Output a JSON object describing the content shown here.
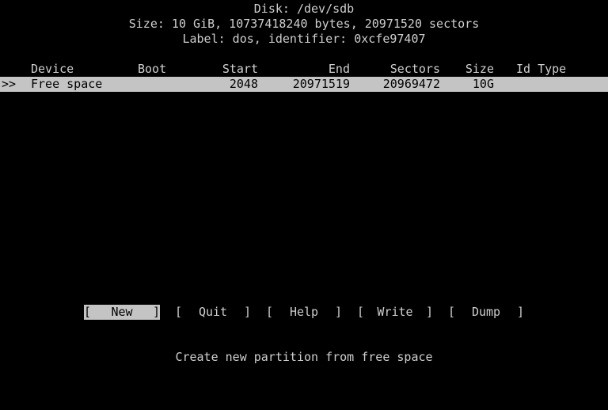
{
  "disk": {
    "title": "Disk: /dev/sdb",
    "size_line": "Size: 10 GiB, 10737418240 bytes, 20971520 sectors",
    "label_line": "Label: dos, identifier: 0xcfe97407"
  },
  "table": {
    "headers": {
      "device": "Device",
      "boot": "Boot",
      "start": "Start",
      "end": "End",
      "sectors": "Sectors",
      "size": "Size",
      "id_type": "Id Type"
    },
    "rows": [
      {
        "cursor": ">>",
        "device": "Free space",
        "boot": "",
        "start": "2048",
        "end": "20971519",
        "sectors": "20969472",
        "size": "10G",
        "id_type": ""
      }
    ]
  },
  "menu": {
    "items": [
      {
        "open": "[",
        "label": "New",
        "close": "]"
      },
      {
        "open": "[",
        "label": "Quit",
        "close": "]"
      },
      {
        "open": "[",
        "label": "Help",
        "close": "]"
      },
      {
        "open": "[",
        "label": "Write",
        "close": "]"
      },
      {
        "open": "[",
        "label": "Dump",
        "close": "]"
      }
    ],
    "selected": "New"
  },
  "hint": "Create new partition from free space",
  "colors": {
    "background": "#000000",
    "text": "#cfcfcf",
    "highlight": "#c4c4c4"
  }
}
